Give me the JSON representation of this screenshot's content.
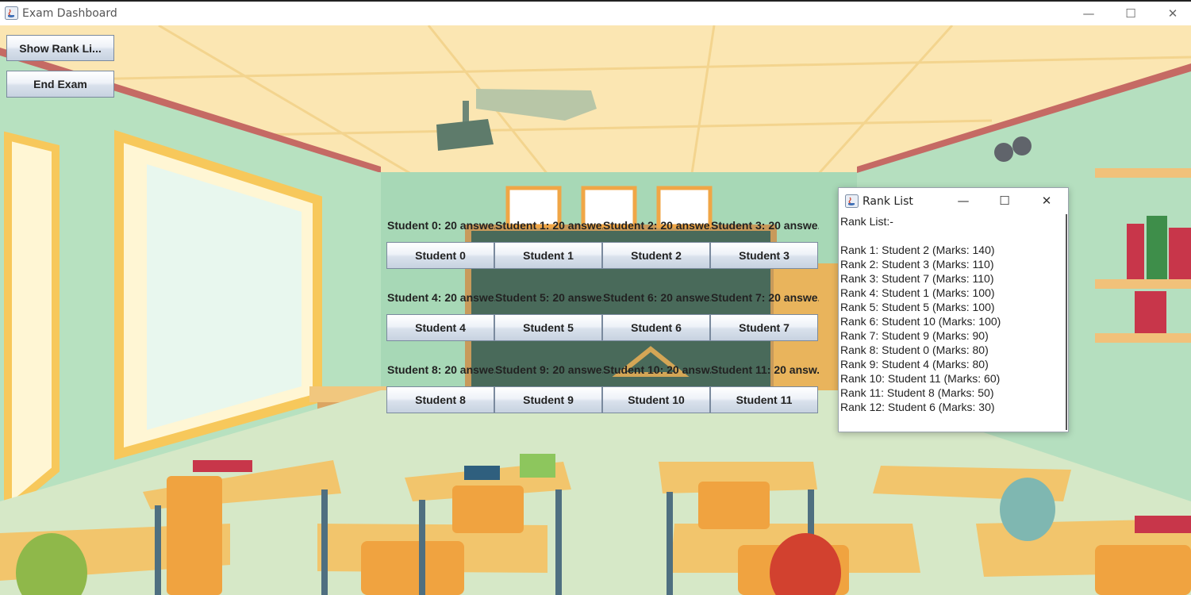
{
  "window": {
    "title": "Exam Dashboard",
    "minimize": "—",
    "maximize": "☐",
    "close": "✕"
  },
  "sidebar": {
    "show_rank_label": "Show Rank Li...",
    "end_exam_label": "End Exam"
  },
  "students": [
    {
      "label": "Student 0: 20 answe..",
      "button": "Student 0"
    },
    {
      "label": "Student 1: 20 answe..",
      "button": "Student 1"
    },
    {
      "label": "Student 2: 20 answe..",
      "button": "Student 2"
    },
    {
      "label": "Student 3: 20 answe..",
      "button": "Student 3"
    },
    {
      "label": "Student 4: 20 answe..",
      "button": "Student 4"
    },
    {
      "label": "Student 5: 20 answe..",
      "button": "Student 5"
    },
    {
      "label": "Student 6: 20 answe..",
      "button": "Student 6"
    },
    {
      "label": "Student 7: 20 answe..",
      "button": "Student 7"
    },
    {
      "label": "Student 8: 20 answe..",
      "button": "Student 8"
    },
    {
      "label": "Student 9: 20 answe..",
      "button": "Student 9"
    },
    {
      "label": "Student 10: 20 answ..",
      "button": "Student 10"
    },
    {
      "label": "Student 11: 20 answ..",
      "button": "Student 11"
    }
  ],
  "rank_window": {
    "title": "Rank List",
    "minimize": "—",
    "maximize": "☐",
    "close": "✕",
    "lines": [
      "Rank List:-",
      "",
      "Rank 1: Student 2 (Marks: 140)",
      "Rank 2: Student 3 (Marks: 110)",
      "Rank 3: Student 7 (Marks: 110)",
      "Rank 4: Student 1 (Marks: 100)",
      "Rank 5: Student 5 (Marks: 100)",
      "Rank 6: Student 10 (Marks: 100)",
      "Rank 7: Student 9 (Marks: 90)",
      "Rank 8: Student 0 (Marks: 80)",
      "Rank 9: Student 4 (Marks: 80)",
      "Rank 10: Student 11 (Marks: 60)",
      "Rank 11: Student 8 (Marks: 50)",
      "Rank 12: Student 6 (Marks: 30)"
    ]
  }
}
